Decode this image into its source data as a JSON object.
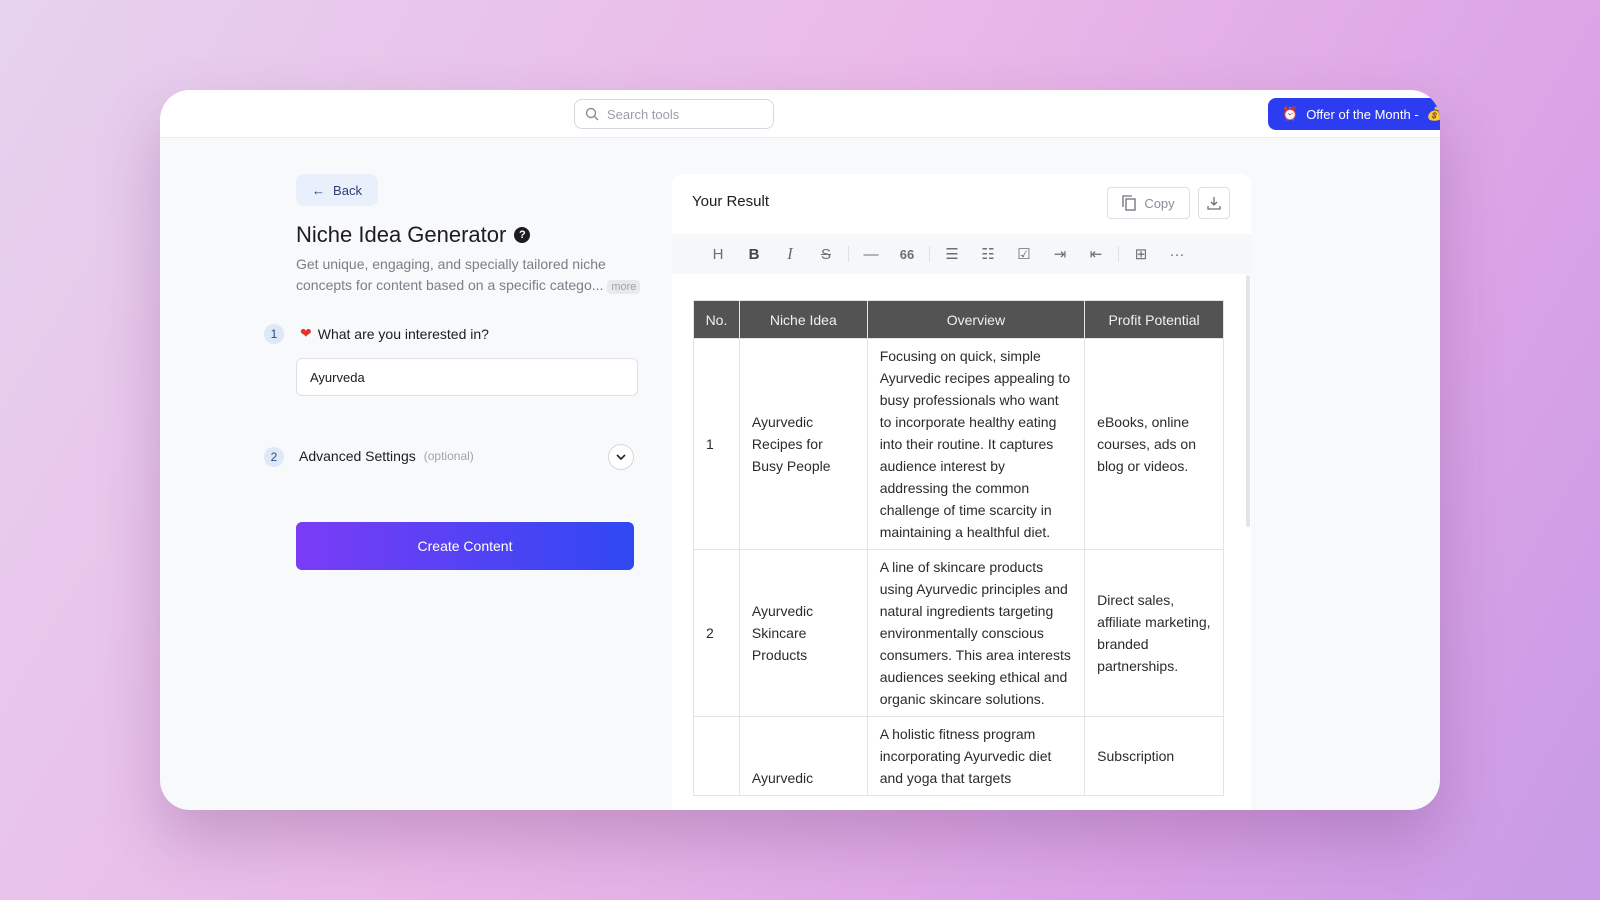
{
  "header": {
    "search_placeholder": "Search tools",
    "offer_label": "Offer of the Month -"
  },
  "left": {
    "back_label": "Back",
    "title": "Niche Idea Generator",
    "description": "Get unique, engaging, and specially tailored niche concepts for content based on a specific catego...",
    "more_label": "more",
    "step1": {
      "number": "1",
      "label": "What are you interested in?",
      "value": "Ayurveda"
    },
    "step2": {
      "number": "2",
      "label": "Advanced Settings",
      "optional": "(optional)"
    },
    "create_label": "Create Content"
  },
  "result": {
    "title": "Your Result",
    "copy_label": "Copy",
    "toolbar": [
      "heading",
      "bold",
      "italic",
      "strikethrough",
      "horizontal-rule",
      "quote",
      "bullet-list",
      "numbered-list",
      "checklist",
      "indent",
      "outdent",
      "table",
      "more"
    ],
    "table": {
      "headers": [
        "No.",
        "Niche Idea",
        "Overview",
        "Profit Potential"
      ],
      "rows": [
        [
          "1",
          "Ayurvedic Recipes for Busy People",
          "Focusing on quick, simple Ayurvedic recipes appealing to busy professionals who want to incorporate healthy eating into their routine. It captures audience interest by addressing the common challenge of time scarcity in maintaining a healthful diet.",
          "eBooks, online courses, ads on blog or videos."
        ],
        [
          "2",
          "Ayurvedic Skincare Products",
          "A line of skincare products using Ayurvedic principles and natural ingredients targeting environmentally conscious consumers. This area interests audiences seeking ethical and organic skincare solutions.",
          "Direct sales, affiliate marketing, branded partnerships."
        ],
        [
          "",
          "Ayurvedic",
          "A holistic fitness program incorporating Ayurvedic diet and yoga that targets",
          "Subscription"
        ]
      ]
    }
  },
  "colors": {
    "accent": "#2c3cf0",
    "button_gradient_start": "#7a3cf6",
    "button_gradient_end": "#2f48f2",
    "table_header": "#535353"
  }
}
